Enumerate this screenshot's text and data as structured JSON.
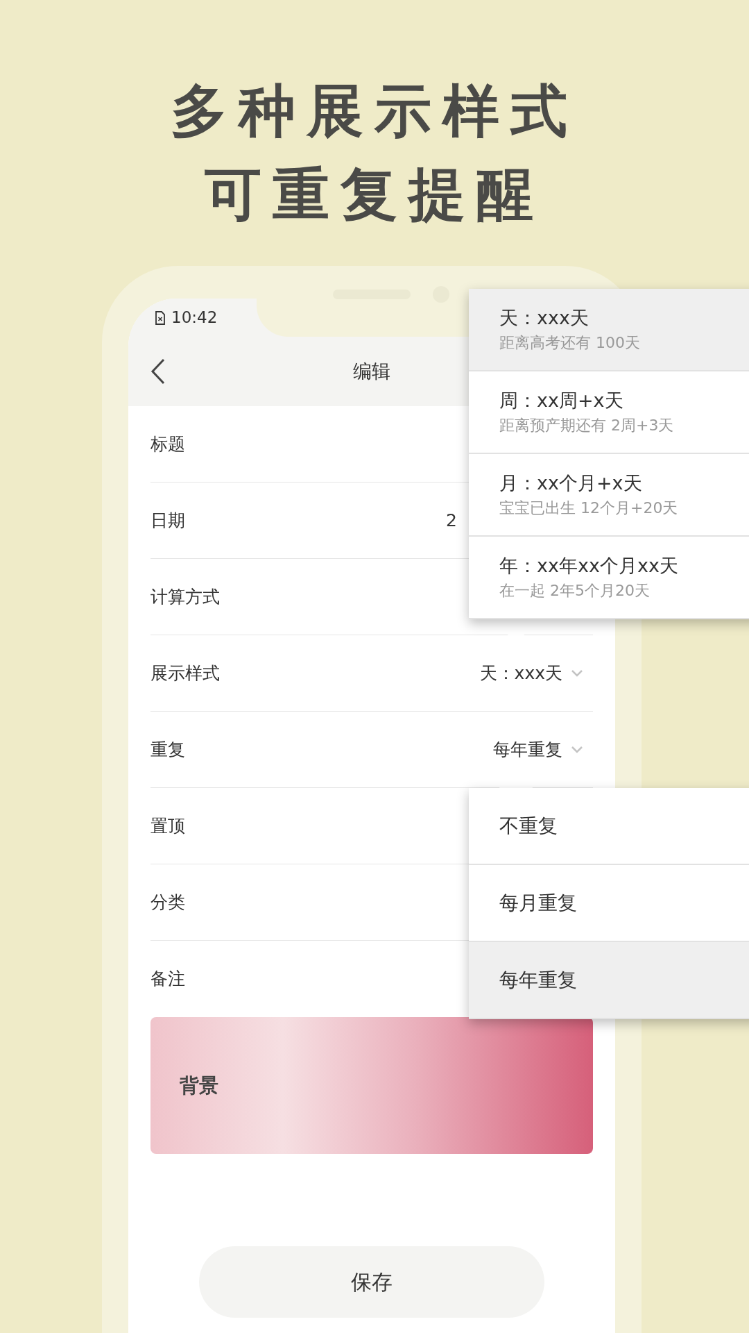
{
  "headline": [
    "多种展示样式",
    "可重复提醒"
  ],
  "status_bar": {
    "time": "10:42"
  },
  "header": {
    "title": "编辑"
  },
  "rows": [
    {
      "label": "标题"
    },
    {
      "label": "日期",
      "value": "2"
    },
    {
      "label": "计算方式"
    },
    {
      "label": "展示样式",
      "value": "天：xxx天",
      "dropdown": true
    },
    {
      "label": "重复",
      "value": "每年重复",
      "dropdown": true
    },
    {
      "label": "置顶"
    },
    {
      "label": "分类"
    },
    {
      "label": "备注"
    }
  ],
  "background_card": {
    "label": "背景"
  },
  "save_button": "保存",
  "style_menu": {
    "items": [
      {
        "title": "天：xxx天",
        "example": "距离高考还有 100天",
        "selected": true
      },
      {
        "title": "周：xx周+x天",
        "example": "距离预产期还有 2周+3天",
        "selected": false
      },
      {
        "title": "月：xx个月+x天",
        "example": "宝宝已出生 12个月+20天",
        "selected": false
      },
      {
        "title": "年：xx年xx个月xx天",
        "example": "在一起 2年5个月20天",
        "selected": false
      }
    ]
  },
  "repeat_menu": {
    "items": [
      {
        "label": "不重复",
        "selected": false
      },
      {
        "label": "每月重复",
        "selected": false
      },
      {
        "label": "每年重复",
        "selected": true
      }
    ]
  }
}
